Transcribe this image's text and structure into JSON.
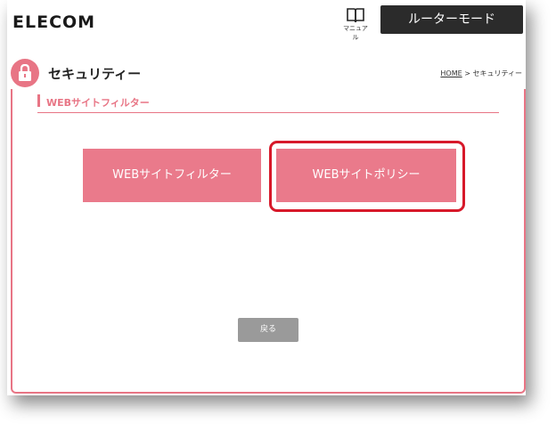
{
  "header": {
    "logo": "ELECOM",
    "manual_label": "マニュアル",
    "mode_label": "ルーターモード"
  },
  "title_bar": {
    "page_title": "セキュリティー",
    "breadcrumb": {
      "home": "HOME",
      "separator": " > ",
      "current": "セキュリティー"
    }
  },
  "section": {
    "heading": "WEBサイトフィルター"
  },
  "buttons": {
    "filter": "WEBサイトフィルター",
    "policy": "WEBサイトポリシー",
    "back": "戻る"
  },
  "colors": {
    "accent_pink": "#e87585",
    "button_pink": "#ea7a8b",
    "highlight_red": "#d7192a",
    "mode_bg": "#2b2b2b",
    "back_gray": "#9a9a9a"
  },
  "icons": {
    "manual": "book-icon",
    "title": "lock-icon"
  }
}
